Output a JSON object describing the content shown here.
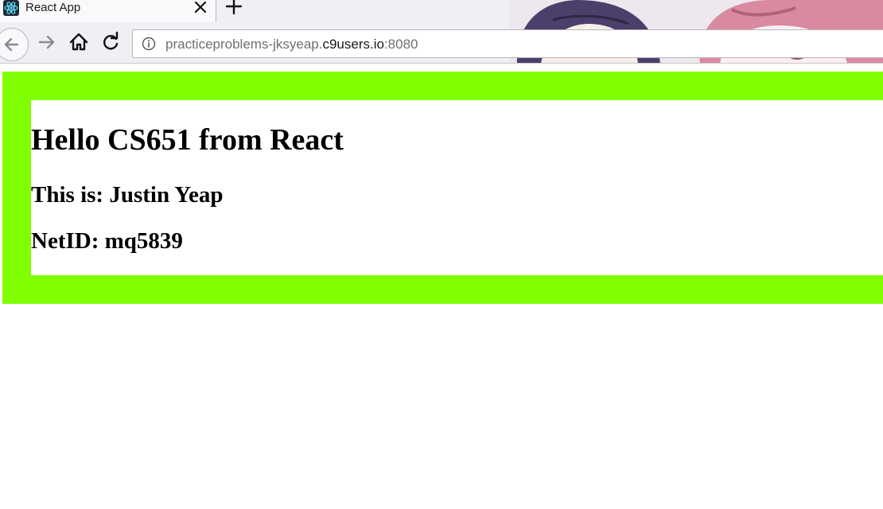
{
  "browser": {
    "tab": {
      "title": "React App"
    },
    "address_bar": {
      "url_prefix": "practiceproblems-jksyeap.",
      "url_host": "c9users.io",
      "url_suffix": ":8080"
    }
  },
  "page": {
    "heading": "Hello CS651 from React",
    "name_line": "This is: Justin Yeap",
    "netid_line": "NetID: mq5839",
    "background_color": "#7fff00"
  }
}
